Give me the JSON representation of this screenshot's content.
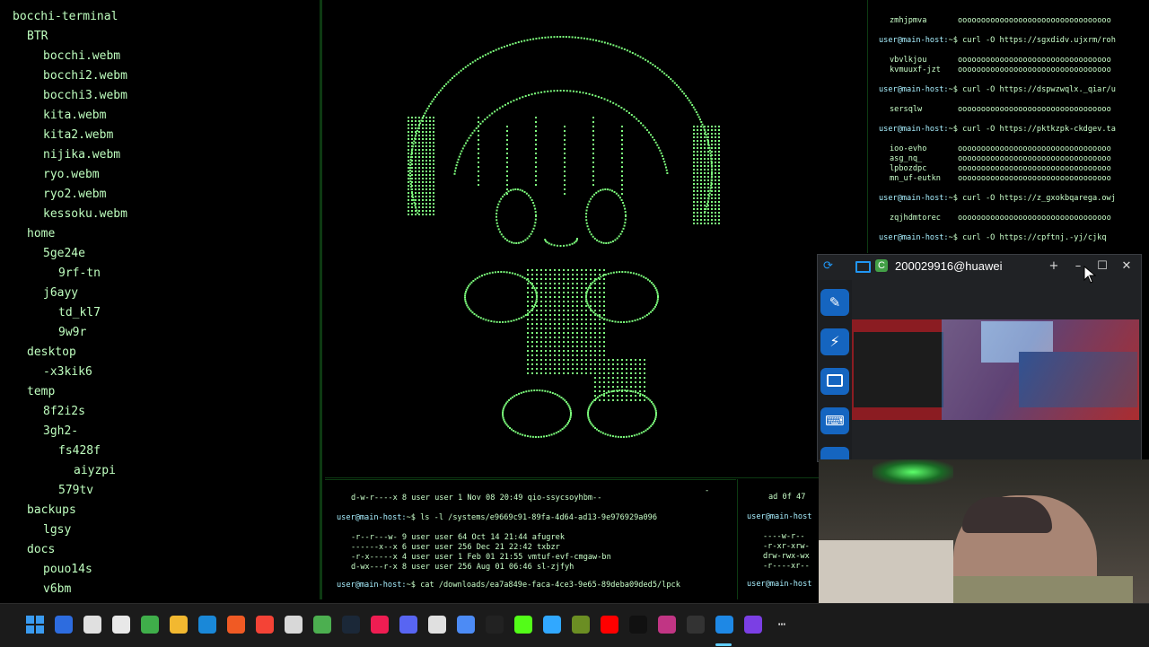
{
  "tree": {
    "root": "bocchi-terminal",
    "items": [
      {
        "label": "BTR"
      },
      {
        "label": "bocchi.webm"
      },
      {
        "label": "bocchi2.webm"
      },
      {
        "label": "bocchi3.webm"
      },
      {
        "label": "kita.webm"
      },
      {
        "label": "kita2.webm"
      },
      {
        "label": "nijika.webm"
      },
      {
        "label": "ryo.webm"
      },
      {
        "label": "ryo2.webm"
      },
      {
        "label": "kessoku.webm"
      },
      {
        "label": "home"
      },
      {
        "label": "5ge24e"
      },
      {
        "label": "9rf-tn"
      },
      {
        "label": "j6ayy"
      },
      {
        "label": "td_kl7"
      },
      {
        "label": "9w9r"
      },
      {
        "label": "desktop"
      },
      {
        "label": "-x3kik6"
      },
      {
        "label": "temp"
      },
      {
        "label": "8f2i2s"
      },
      {
        "label": "3gh2-"
      },
      {
        "label": "fs428f"
      },
      {
        "label": "aiyzpi"
      },
      {
        "label": "579tv"
      },
      {
        "label": "backups"
      },
      {
        "label": "lgsy"
      },
      {
        "label": "docs"
      },
      {
        "label": "pouo14s"
      },
      {
        "label": "v6bm"
      }
    ]
  },
  "right_terminal": {
    "lines": [
      {
        "name": "zmhjpmva",
        "bar": "ooooooooooooooooooooooooooooooooo"
      },
      {
        "prompt": "user@main-host:",
        "cmd": "~$ curl -O https://sgxdidv.ujxrm/roh"
      },
      {
        "name": "vbvlkjou",
        "bar": "ooooooooooooooooooooooooooooooooo"
      },
      {
        "name": "kvmuuxf-jzt",
        "bar": "ooooooooooooooooooooooooooooooooo"
      },
      {
        "prompt": "user@main-host:",
        "cmd": "~$ curl -O https://dspwzwqlx._qiar/u"
      },
      {
        "name": "sersqlw",
        "bar": "ooooooooooooooooooooooooooooooooo"
      },
      {
        "prompt": "user@main-host:",
        "cmd": "~$ curl -O https://pktkzpk-ckdgev.ta"
      },
      {
        "name": "ioo-evho",
        "bar": "ooooooooooooooooooooooooooooooooo"
      },
      {
        "name": "asg_nq_",
        "bar": "ooooooooooooooooooooooooooooooooo"
      },
      {
        "name": "lpbozdpc",
        "bar": "ooooooooooooooooooooooooooooooooo"
      },
      {
        "name": "mn_uf-eutkn",
        "bar": "ooooooooooooooooooooooooooooooooo"
      },
      {
        "prompt": "user@main-host:",
        "cmd": "~$ curl -O https://z_gxokbqarega.owj"
      },
      {
        "name": "zqjhdmtorec",
        "bar": "ooooooooooooooooooooooooooooooooo"
      },
      {
        "prompt": "user@main-host:",
        "cmd": "~$ curl -O https://cpftnj.-yj/cjkq"
      }
    ]
  },
  "bottom_terminal": {
    "line0": "d-w-r----x  8  user user  1      Nov 08 20:49  qio-ssycsoyhbm--",
    "prompt1": "user@main-host:",
    "cmd1": "~$ ls -l /systems/e9669c91-89fa-4d64-ad13-9e976929a096",
    "rows": [
      "-r--r---w-  9  user user  64     Oct 14 21:44  afugrek",
      "------x--x  6  user user  256    Dec 21 22:42  txbzr",
      "-r-x-----x  4  user user  1      Feb 01 21:55  vmtuf-evf-cmgaw-bn",
      "d-wx---r-x  8  user user  256    Aug 01 06:46  sl-zjfyh"
    ],
    "prompt2": "user@main-host:",
    "cmd2": "~$ cat /downloads/ea7a849e-faca-4ce3-9e65-89deba09ded5/lpck"
  },
  "bottom_terminal2": {
    "line0": "ad  0f  47",
    "prompt1": "user@main-host",
    "rows": [
      "----w-r--",
      "-r-xr-xrw-",
      "drw-rwx-wx",
      "-r----xr--"
    ],
    "prompt2": "user@main-host"
  },
  "remote_window": {
    "title": "200029916@huawei",
    "add_tab": "+",
    "minimize": "–",
    "maximize": "☐",
    "close": "✕"
  },
  "colors": {
    "terminal_green": "#7dff7d",
    "accent_blue": "#1565c0",
    "taskbar_bg": "#1b1b1b"
  },
  "taskbar": {
    "icons": [
      "windows-start-icon",
      "app-icon",
      "obs-icon",
      "app-icon",
      "calculator-icon",
      "file-explorer-icon",
      "edge-icon",
      "brave-icon",
      "app-icon",
      "chatgpt-icon",
      "minecraft-icon",
      "steam-icon",
      "tiktok-icon",
      "discord-icon",
      "settings-icon",
      "gemini-icon",
      "app-icon",
      "kick-icon",
      "photoshop-icon",
      "minecraft-icon",
      "youtube-icon",
      "tiktok-icon",
      "instagram-icon",
      "epic-games-icon",
      "remote-desktop-icon",
      "app-icon",
      "more-icon"
    ]
  }
}
